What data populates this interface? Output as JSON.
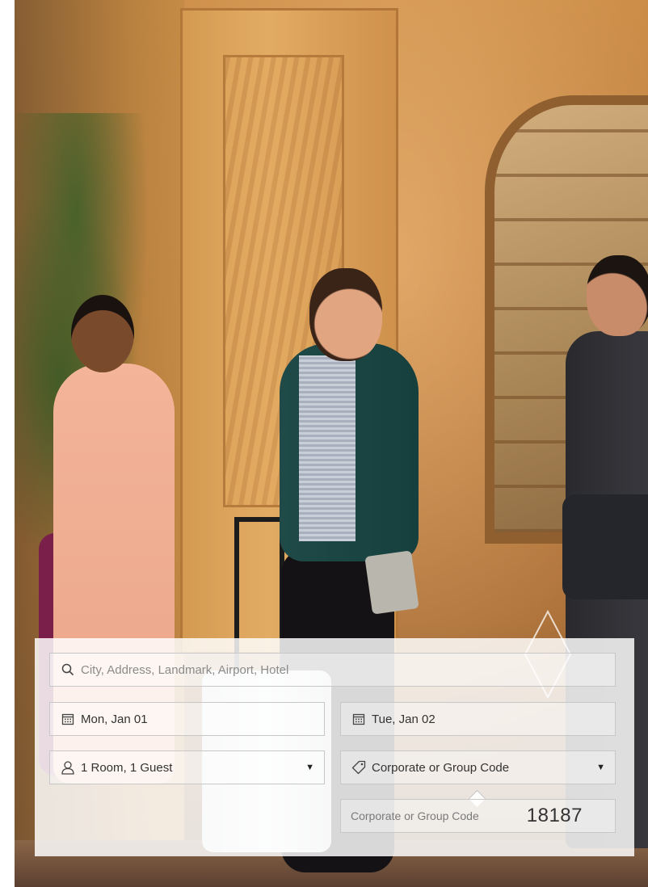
{
  "search": {
    "placeholder": "City, Address, Landmark, Airport, Hotel",
    "icon": "search-icon"
  },
  "dates": {
    "checkin": "Mon, Jan 01",
    "checkout": "Tue, Jan 02",
    "icon": "calendar-icon"
  },
  "rooms": {
    "value": "1 Room, 1 Guest",
    "icon": "person-icon"
  },
  "special_rates": {
    "value": "Corporate or Group Code",
    "icon": "tag-icon"
  },
  "corporate_code": {
    "label": "Corporate or Group Code",
    "value": "18187"
  },
  "colors": {
    "form_background": "#ffffff",
    "field_border": "#c7c7c7",
    "text": "#333333",
    "placeholder": "#8b8b8b"
  }
}
